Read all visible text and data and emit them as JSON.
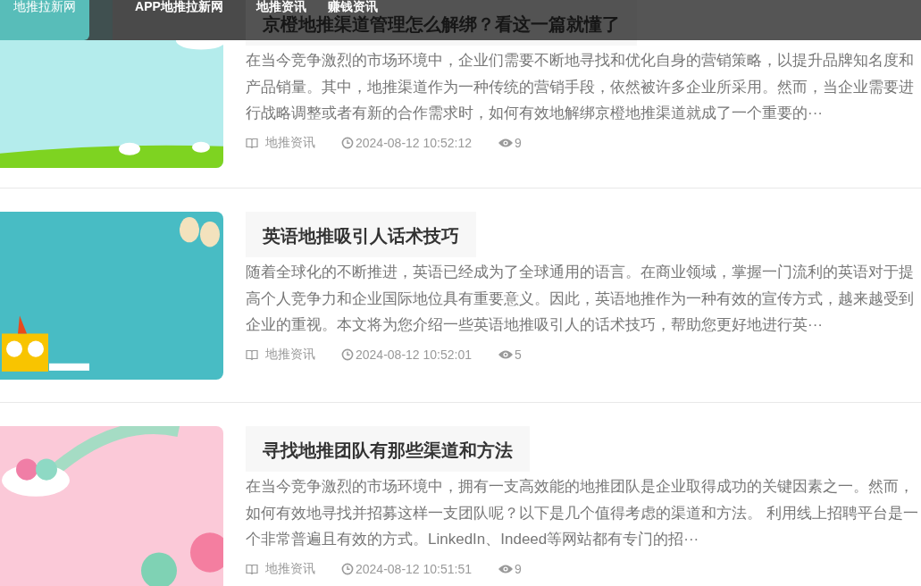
{
  "nav": {
    "logo": "地推拉新网",
    "items": [
      {
        "label": "APP地推拉新网",
        "selected": true
      },
      {
        "label": "地推资讯",
        "selected": false
      },
      {
        "label": "赚钱资讯",
        "selected": false
      }
    ]
  },
  "articles": [
    {
      "title": "京橙地推渠道管理怎么解绑？看这一篇就懂了",
      "summary": "在当今竞争激烈的市场环境中，企业们需要不断地寻找和优化自身的营销策略，以提升品牌知名度和产品销量。其中，地推渠道作为一种传统的营销手段，依然被许多企业所采用。然而，当企业需要进行战略调整或者有新的合作需求时，如何有效地解绑京橙地推渠道就成了一个重要的···",
      "category": "地推资讯",
      "time": "2024-08-12 10:52:12",
      "views": "9"
    },
    {
      "title": "英语地推吸引人话术技巧",
      "summary": "随着全球化的不断推进，英语已经成为了全球通用的语言。在商业领域，掌握一门流利的英语对于提高个人竞争力和企业国际地位具有重要意义。因此，英语地推作为一种有效的宣传方式，越来越受到企业的重视。本文将为您介绍一些英语地推吸引人的话术技巧，帮助您更好地进行英···",
      "category": "地推资讯",
      "time": "2024-08-12 10:52:01",
      "views": "5"
    },
    {
      "title": "寻找地推团队有那些渠道和方法",
      "summary": "在当今竞争激烈的市场环境中，拥有一支高效能的地推团队是企业取得成功的关键因素之一。然而，如何有效地寻找并招募这样一支团队呢？以下是几个值得考虑的渠道和方法。 利用线上招聘平台是一个非常普遍且有效的方式。LinkedIn、Indeed等网站都有专门的招···",
      "category": "地推资讯",
      "time": "2024-08-12 10:51:51",
      "views": "9"
    }
  ]
}
